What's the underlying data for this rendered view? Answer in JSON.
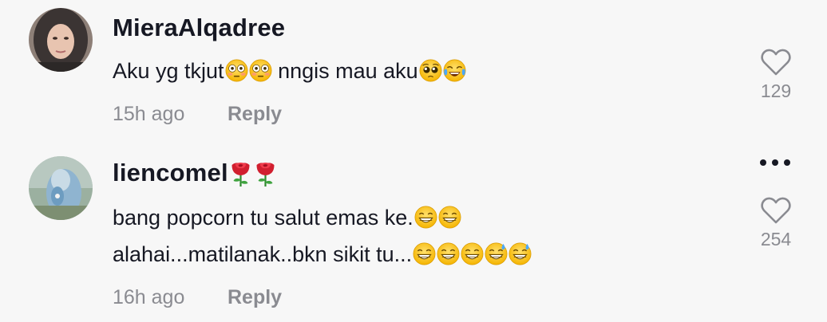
{
  "comments": [
    {
      "username": "MieraAlqadree",
      "text_parts": [
        "Aku yg tkjut",
        " nngis mau aku"
      ],
      "time": "15h ago",
      "reply_label": "Reply",
      "likes": "129",
      "emojis": [
        "flushed-face",
        "flushed-face",
        "pleading-face",
        "tears-of-joy"
      ]
    },
    {
      "username": "liencomel",
      "username_emojis": [
        "rose",
        "rose"
      ],
      "line1": "bang popcorn tu salut emas ke.",
      "line2": "alahai...matilanak..bkn sikit tu...",
      "time": "16h ago",
      "reply_label": "Reply",
      "likes": "254",
      "emojis": [
        "grinning-face",
        "grinning-face",
        "grinning-face",
        "grinning-face",
        "grinning-face",
        "grinning-sweat-face",
        "grinning-sweat-face"
      ]
    }
  ]
}
